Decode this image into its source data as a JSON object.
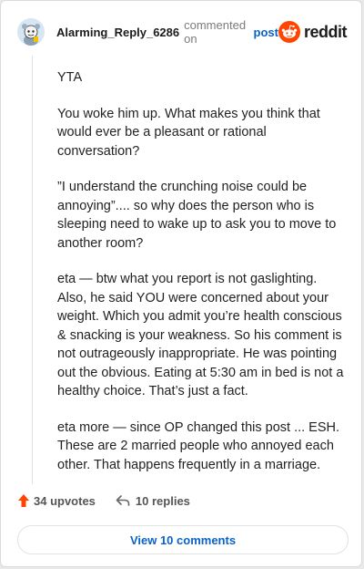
{
  "comment": {
    "username": "Alarming_Reply_6286",
    "commented_text": "commented on",
    "post_link": "post",
    "brand": "reddit",
    "paragraphs": [
      "YTA",
      "You woke him up. What makes you think that would ever be a pleasant or rational conversation?",
      "”I understand the crunching noise could be annoying”.... so why does the person who is sleeping need to wake up to ask you to move to another room?",
      "eta — btw what you report is not gaslighting. Also, he said YOU were concerned about your weight. Which you admit you’re health conscious & snacking is your weakness. So his comment is not outrageously inappropriate. He was pointing out the obvious. Eating at 5:30 am in bed is not a healthy choice. That’s just a fact.",
      "eta more — since OP changed this post ... ESH. These are 2 married people who annoyed each other. That happens frequently in a marriage."
    ]
  },
  "actions": {
    "upvotes": "34 upvotes",
    "replies": "10 replies",
    "view_comments": "View 10 comments"
  },
  "colors": {
    "upvote": "#ff4500",
    "link": "#0b62c6",
    "brand": "#ff4500"
  },
  "icons": {
    "avatar": "snoo-avatar-icon",
    "brand": "reddit-logo-icon",
    "upvote": "upvote-arrow-icon",
    "reply": "reply-arrow-icon"
  }
}
